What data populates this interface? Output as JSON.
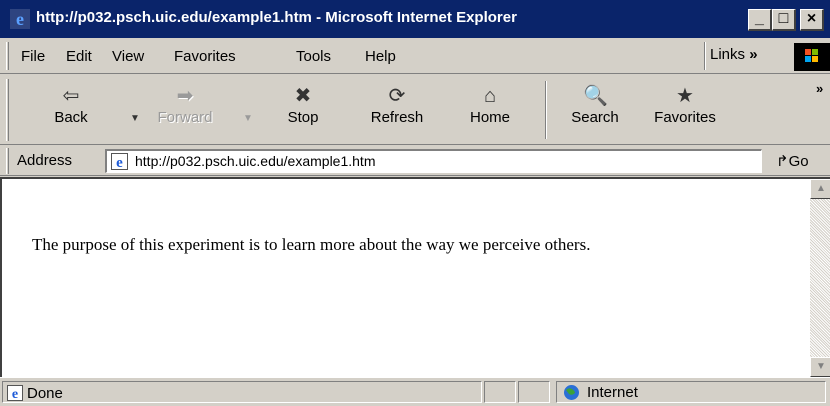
{
  "window": {
    "title": "http://p032.psch.uic.edu/example1.htm - Microsoft Internet Explorer",
    "controls": {
      "minimize": "_",
      "maximize": "□",
      "close": "×"
    }
  },
  "menu": {
    "items": [
      "File",
      "Edit",
      "View",
      "Favorites",
      "Tools",
      "Help"
    ],
    "links_label": "Links",
    "links_chevron": "»"
  },
  "toolbar": {
    "buttons": [
      {
        "label": "Back",
        "icon": "back-arrow-icon",
        "glyph": "⇦",
        "enabled": true
      },
      {
        "label": "Forward",
        "icon": "forward-arrow-icon",
        "glyph": "➡",
        "enabled": false
      },
      {
        "label": "Stop",
        "icon": "stop-icon",
        "glyph": "✖",
        "enabled": true
      },
      {
        "label": "Refresh",
        "icon": "refresh-icon",
        "glyph": "⟳",
        "enabled": true
      },
      {
        "label": "Home",
        "icon": "home-icon",
        "glyph": "⌂",
        "enabled": true
      },
      {
        "label": "Search",
        "icon": "search-icon",
        "glyph": "🔍",
        "enabled": true
      },
      {
        "label": "Favorites",
        "icon": "favorites-icon",
        "glyph": "★",
        "enabled": true
      }
    ],
    "dropdown_glyph": "▼",
    "overflow": "»"
  },
  "address": {
    "label": "Address",
    "value": "http://p032.psch.uic.edu/example1.htm",
    "go_label": "Go",
    "go_glyph": "↱"
  },
  "page": {
    "text": "The purpose of this experiment is to learn more about the way we perceive others."
  },
  "status": {
    "text": "Done",
    "zone": "Internet"
  },
  "colors": {
    "title_bar": "#0a246a",
    "chrome": "#d4d0c8",
    "content_bg": "#ffffff"
  }
}
